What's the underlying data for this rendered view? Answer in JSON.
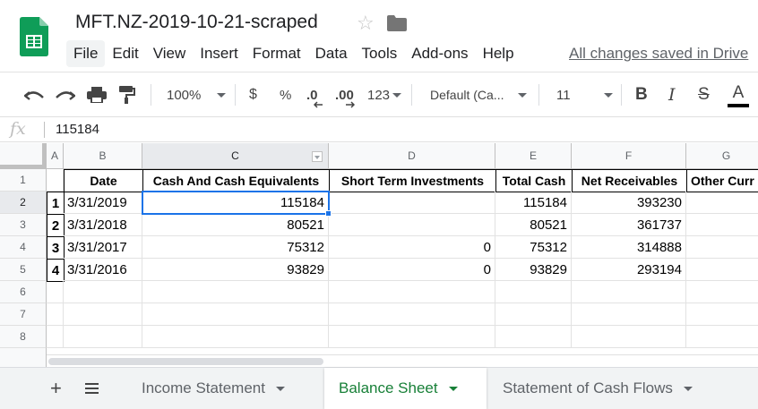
{
  "app": {
    "title": "MFT.NZ-2019-10-21-scraped",
    "saved_status": "All changes saved in Drive",
    "menu": [
      "File",
      "Edit",
      "View",
      "Insert",
      "Format",
      "Data",
      "Tools",
      "Add-ons",
      "Help"
    ]
  },
  "toolbar": {
    "zoom": "100%",
    "currency": "$",
    "percent": "%",
    "decrease_decimal": ".0",
    "increase_decimal": ".00",
    "number_format": "123",
    "font": "Default (Ca...",
    "font_size": "11",
    "bold": "B",
    "italic": "I",
    "strike": "S",
    "text_color": "A"
  },
  "formula_bar": {
    "fx": "fx",
    "value": "115184"
  },
  "columns": [
    "A",
    "B",
    "C",
    "D",
    "E",
    "F",
    "G"
  ],
  "rows": [
    "1",
    "2",
    "3",
    "4",
    "5",
    "6",
    "7",
    "8"
  ],
  "table": {
    "headers": [
      "Date",
      "Cash And Cash Equivalents",
      "Short Term Investments",
      "Total Cash",
      "Net Receivables",
      "Other Curr"
    ],
    "data": [
      {
        "idx": "1",
        "date": "3/31/2019",
        "cash": "115184",
        "sti": "",
        "total": "115184",
        "recv": "393230"
      },
      {
        "idx": "2",
        "date": "3/31/2018",
        "cash": "80521",
        "sti": "",
        "total": "80521",
        "recv": "361737"
      },
      {
        "idx": "3",
        "date": "3/31/2017",
        "cash": "75312",
        "sti": "0",
        "total": "75312",
        "recv": "314888"
      },
      {
        "idx": "4",
        "date": "3/31/2016",
        "cash": "93829",
        "sti": "0",
        "total": "93829",
        "recv": "293194"
      }
    ]
  },
  "sheets": [
    "Income Statement",
    "Balance Sheet",
    "Statement of Cash Flows"
  ],
  "colors": {
    "accent": "#1a73e8",
    "active_sheet": "#188038",
    "logo": "#0f9d58"
  }
}
